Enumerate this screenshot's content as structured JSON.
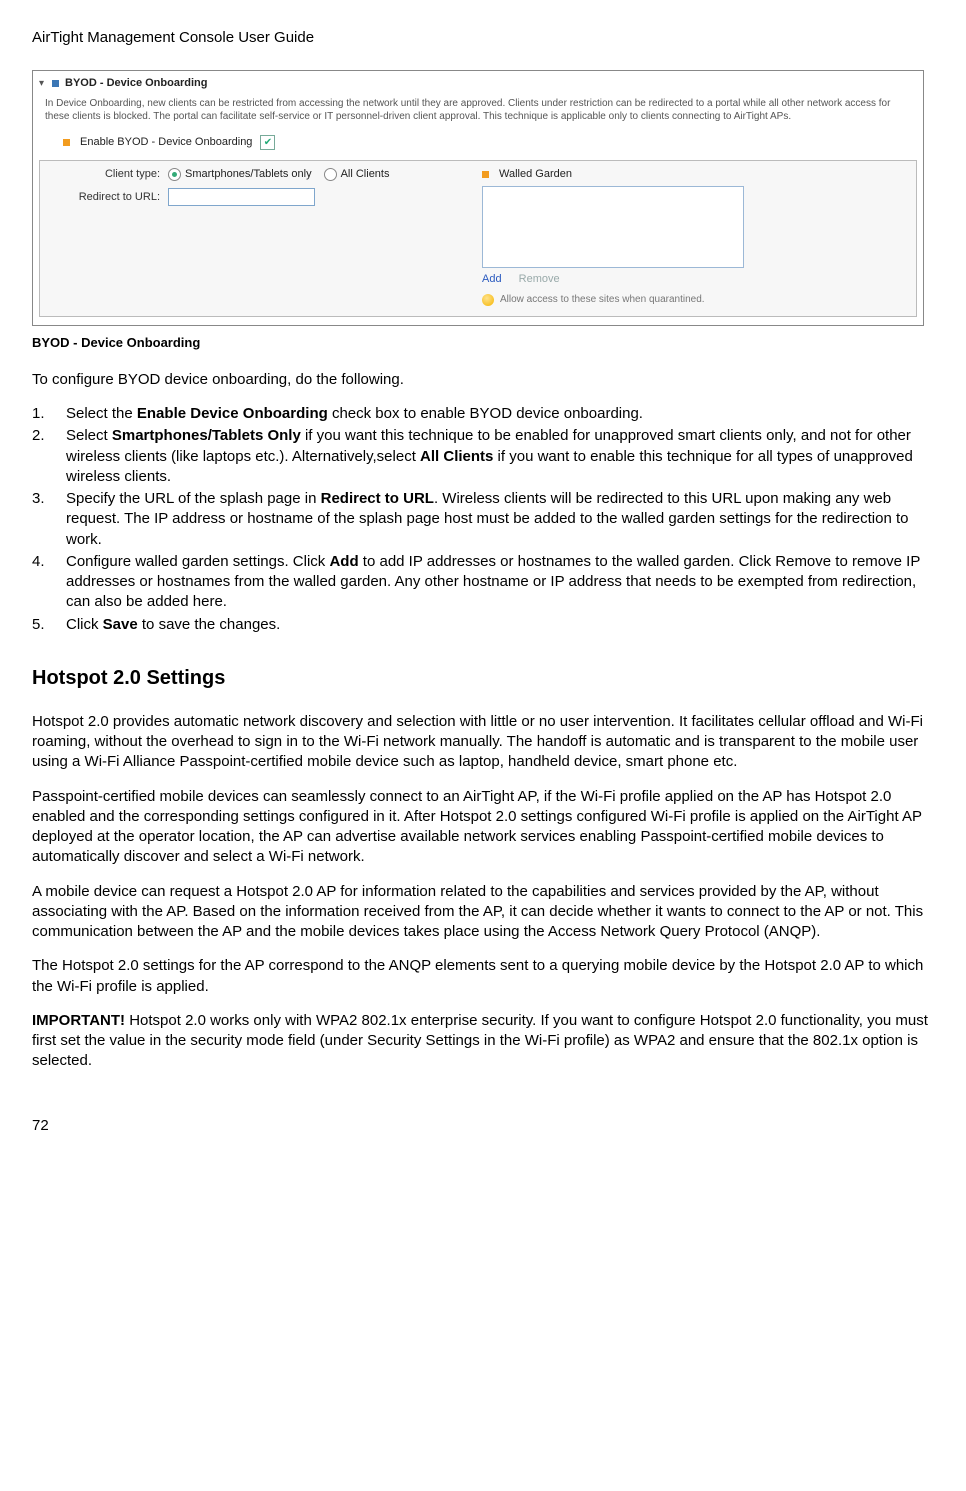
{
  "doc": {
    "header": "AirTight Management Console User Guide",
    "page_number": "72"
  },
  "screenshot": {
    "title": "BYOD - Device Onboarding",
    "description": "In Device Onboarding, new clients can be restricted from accessing the network until they are approved. Clients under restriction can be redirected to a portal while all other network access for these clients is blocked. The portal can facilitate self-service or IT personnel-driven client approval. This technique is applicable only to clients connecting to AirTight APs.",
    "enable_label": "Enable BYOD - Device Onboarding",
    "client_type_label": "Client type:",
    "radio1": "Smartphones/Tablets only",
    "radio2": "All Clients",
    "redirect_label": "Redirect to URL:",
    "walled_garden": "Walled Garden",
    "add_link": "Add",
    "remove_link": "Remove",
    "tip": "Allow access to these sites when quarantined."
  },
  "caption": "BYOD - Device Onboarding",
  "intro": "To configure BYOD device onboarding, do the following.",
  "steps": {
    "s1a": "Select the ",
    "s1b": "Enable Device Onboarding",
    "s1c": " check box to enable BYOD device onboarding.",
    "s2a": "Select ",
    "s2b": "Smartphones/Tablets Only",
    "s2c": " if you want this technique to be enabled for unapproved smart clients only, and not for other wireless clients (like laptops etc.). Alternatively,select ",
    "s2d": "All Clients",
    "s2e": " if you want to enable this technique for all types of unapproved wireless clients.",
    "s3a": "Specify the URL of the splash page in ",
    "s3b": "Redirect to URL",
    "s3c": ". Wireless clients will be redirected to this URL upon making any web request. The IP address or hostname of the splash page host must be added to the walled garden settings for the redirection to work.",
    "s4a": "Configure walled garden settings. Click ",
    "s4b": "Add",
    "s4c": " to add IP addresses or hostnames to the walled garden. Click Remove to remove IP addresses or hostnames from the walled garden. Any other hostname or IP address that needs to be exempted from redirection, can also be added here.",
    "s5a": "Click ",
    "s5b": "Save",
    "s5c": " to save the changes."
  },
  "section_heading": "Hotspot 2.0 Settings",
  "p1": "Hotspot 2.0 provides automatic network discovery and selection with little or no user intervention. It facilitates cellular offload and Wi-Fi roaming, without the overhead to sign in to the Wi-Fi network manually. The handoff is automatic and is transparent to the mobile user using a Wi-Fi Alliance Passpoint-certified mobile device such as laptop, handheld device, smart phone etc.",
  "p2": "Passpoint-certified mobile devices can seamlessly connect to an AirTight AP, if the Wi-Fi profile applied on the AP has Hotspot 2.0 enabled and the corresponding settings configured in it. After Hotspot 2.0 settings configured Wi-Fi profile is applied on the AirTight AP deployed at the operator location, the AP can advertise available network services enabling Passpoint-certified mobile devices to automatically discover and select a Wi-Fi network.",
  "p3": "A mobile device can request a Hotspot 2.0 AP for information related to the capabilities and services provided by the AP, without associating with the AP. Based on the information received from the AP, it can decide whether it wants to connect to the AP or not. This communication between the AP and the mobile devices takes place using the Access Network Query Protocol (ANQP).",
  "p4": "The Hotspot 2.0 settings for the AP correspond to the ANQP elements sent to a querying mobile device by the Hotspot 2.0 AP to which the Wi-Fi profile is applied.",
  "p5a": "IMPORTANT!",
  "p5b": " Hotspot 2.0 works only with WPA2 802.1x enterprise security. If you want to configure Hotspot 2.0 functionality, you must first set the value in the security mode field (under Security Settings in the Wi-Fi profile) as WPA2 and ensure that the 802.1x option is selected."
}
